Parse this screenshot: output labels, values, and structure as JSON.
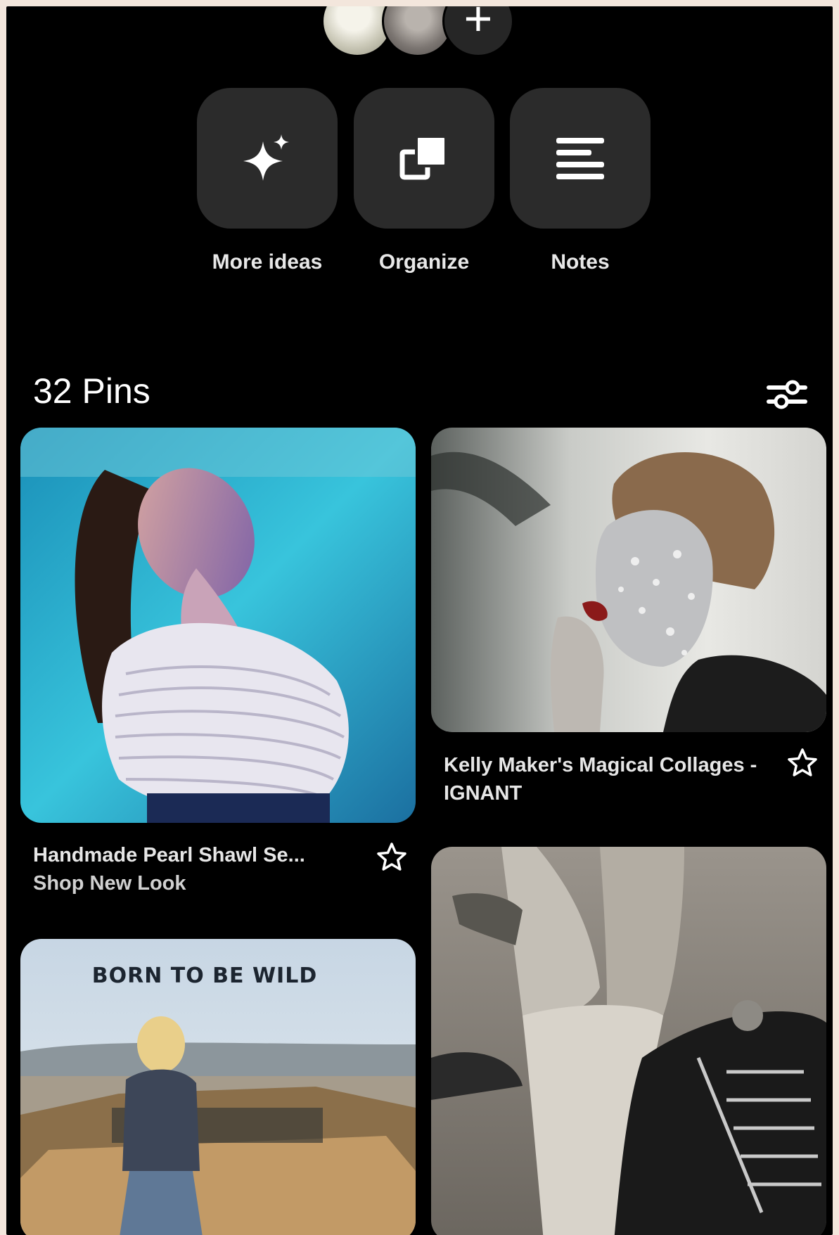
{
  "actions": [
    {
      "label": "More ideas",
      "icon": "sparkle-icon"
    },
    {
      "label": "Organize",
      "icon": "organize-icon"
    },
    {
      "label": "Notes",
      "icon": "notes-icon"
    }
  ],
  "pins_header": {
    "count_label": "32 Pins",
    "filter_icon": "filter-sliders-icon"
  },
  "pins": [
    {
      "title": "Handmade Pearl Shawl Se...",
      "source": "Shop New Look"
    },
    {
      "title": "Kelly Maker's Magical Collages - IGNANT",
      "source": ""
    },
    {
      "overlay_text": "BORN TO BE WILD"
    },
    {}
  ],
  "colors": {
    "background": "#000000",
    "tile": "#2b2b2b",
    "frame": "#f3e6dc"
  }
}
